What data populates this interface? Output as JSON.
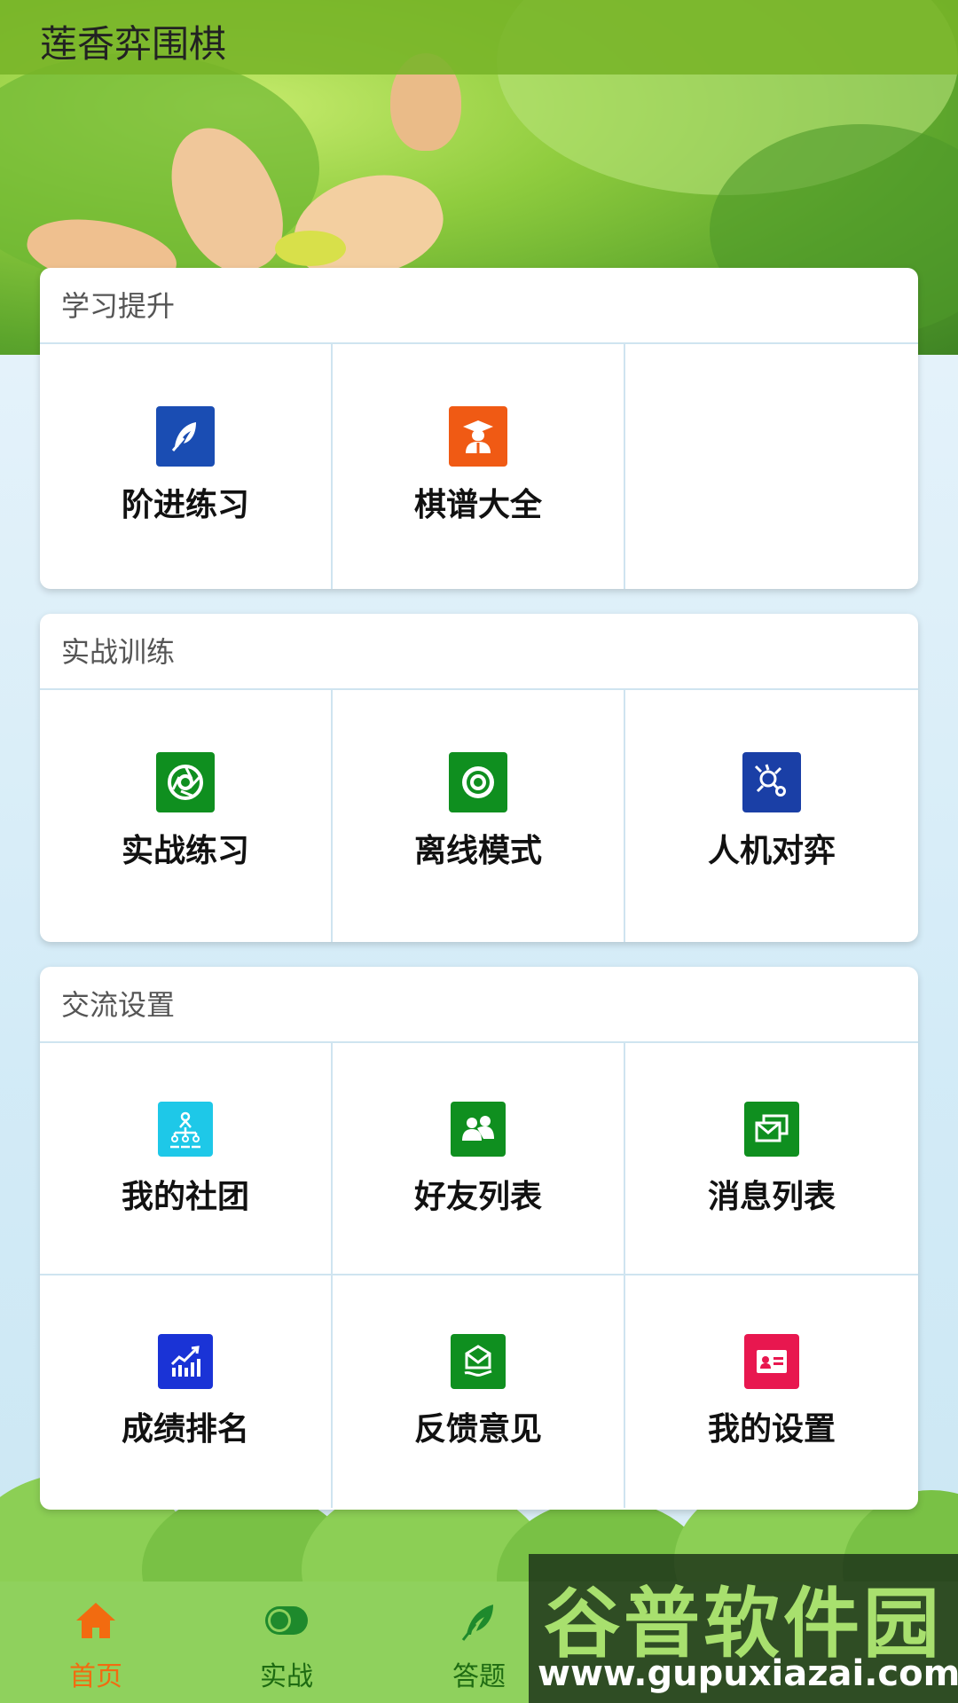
{
  "app": {
    "title": "莲香弈围棋"
  },
  "sections": [
    {
      "title": "学习提升",
      "items": [
        {
          "label": "阶进练习",
          "icon": "feather-icon",
          "color": "#1a4db3"
        },
        {
          "label": "棋谱大全",
          "icon": "graduate-icon",
          "color": "#f05a14"
        },
        {
          "label": "",
          "icon": "",
          "color": ""
        }
      ]
    },
    {
      "title": "实战训练",
      "items": [
        {
          "label": "实战练习",
          "icon": "aperture-icon",
          "color": "#0f8f1f"
        },
        {
          "label": "离线模式",
          "icon": "target-icon",
          "color": "#0f8f1f"
        },
        {
          "label": "人机对弈",
          "icon": "robot-icon",
          "color": "#1a3fa6"
        }
      ]
    },
    {
      "title": "交流设置",
      "items": [
        {
          "label": "我的社团",
          "icon": "org-chart-icon",
          "color": "#1ec8e8"
        },
        {
          "label": "好友列表",
          "icon": "friends-icon",
          "color": "#0f8f1f"
        },
        {
          "label": "消息列表",
          "icon": "message-icon",
          "color": "#0f8f1f"
        },
        {
          "label": "成绩排名",
          "icon": "ranking-chart-icon",
          "color": "#1a33d6"
        },
        {
          "label": "反馈意见",
          "icon": "feedback-icon",
          "color": "#0f8f1f"
        },
        {
          "label": "我的设置",
          "icon": "id-card-icon",
          "color": "#e8174f"
        }
      ]
    }
  ],
  "bottom_nav": [
    {
      "label": "首页",
      "icon": "home-icon",
      "active": true
    },
    {
      "label": "实战",
      "icon": "toggle-icon",
      "active": false
    },
    {
      "label": "答题",
      "icon": "quill-icon",
      "active": false
    }
  ],
  "watermark": {
    "title": "谷普软件园",
    "url": "www.gupuxiazai.com"
  }
}
